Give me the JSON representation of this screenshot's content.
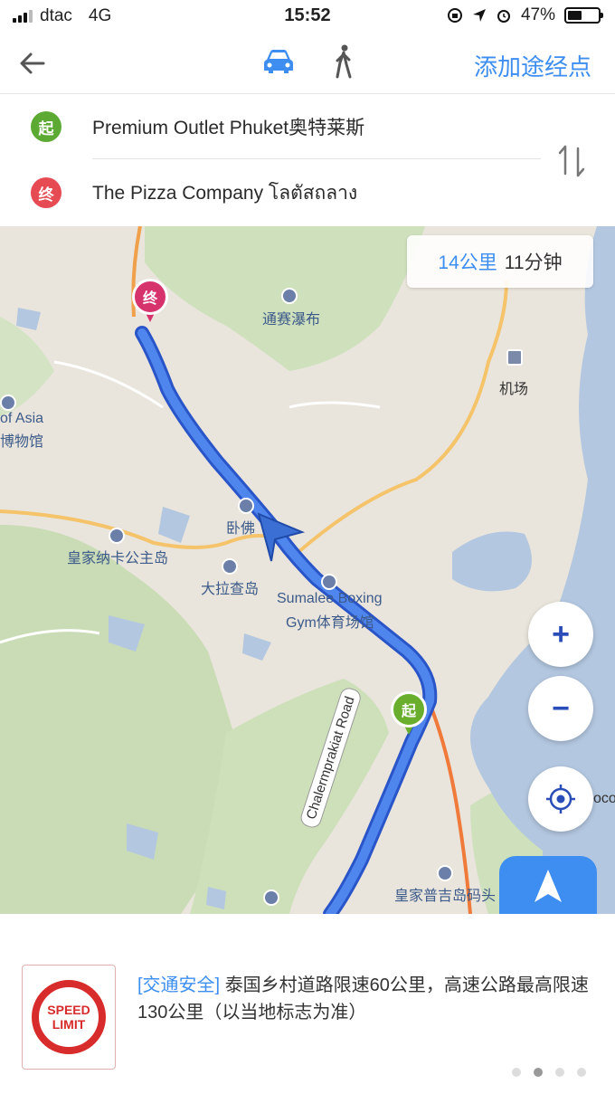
{
  "status_bar": {
    "carrier": "dtac",
    "network": "4G",
    "time": "15:52",
    "battery_text": "47%",
    "battery_level": 0.47
  },
  "header": {
    "back_icon": "back-arrow-icon",
    "modes": [
      {
        "name": "drive",
        "icon": "car-icon",
        "active": true
      },
      {
        "name": "walk",
        "icon": "walking-person-icon",
        "active": false
      }
    ],
    "add_stop_label": "添加途经点"
  },
  "route": {
    "start_badge": "起",
    "start_name": "Premium Outlet Phuket奥特莱斯",
    "end_badge": "终",
    "end_name": "The Pizza Company โลตัสถลาง",
    "swap_icon": "swap-icon"
  },
  "map": {
    "summary_distance": "14公里",
    "summary_time": "11分钟",
    "labels": {
      "waterfall": "通赛瀑布",
      "airport": "机场",
      "asia_line1": "of Asia",
      "asia_line2": "博物馆",
      "buddha": "卧佛",
      "naka": "皇家纳卡公主岛",
      "tarachal": "大拉查岛",
      "boxing_line1": "Sumalee Boxing",
      "boxing_line2": "Gym体育场馆",
      "road": "Chalermprakiat Road",
      "pier": "皇家普吉岛码头",
      "edge": "oco"
    },
    "start_pin": "起",
    "end_pin": "终",
    "zoom_in": "+",
    "zoom_out": "−",
    "locate_icon": "locate-icon",
    "navigate_label": "导航",
    "colors": {
      "route": "#3a6fe0",
      "water": "#b3c7e0",
      "green": "#cfe0bd",
      "road": "#f5b64a",
      "accent": "#3d8ef0"
    }
  },
  "tip": {
    "sign_line1": "SPEED",
    "sign_line2": "LIMIT",
    "tag": "[交通安全]",
    "text": "泰国乡村道路限速60公里，高速公路最高限速130公里（以当地标志为准）",
    "pages": 4,
    "active_page": 1
  }
}
